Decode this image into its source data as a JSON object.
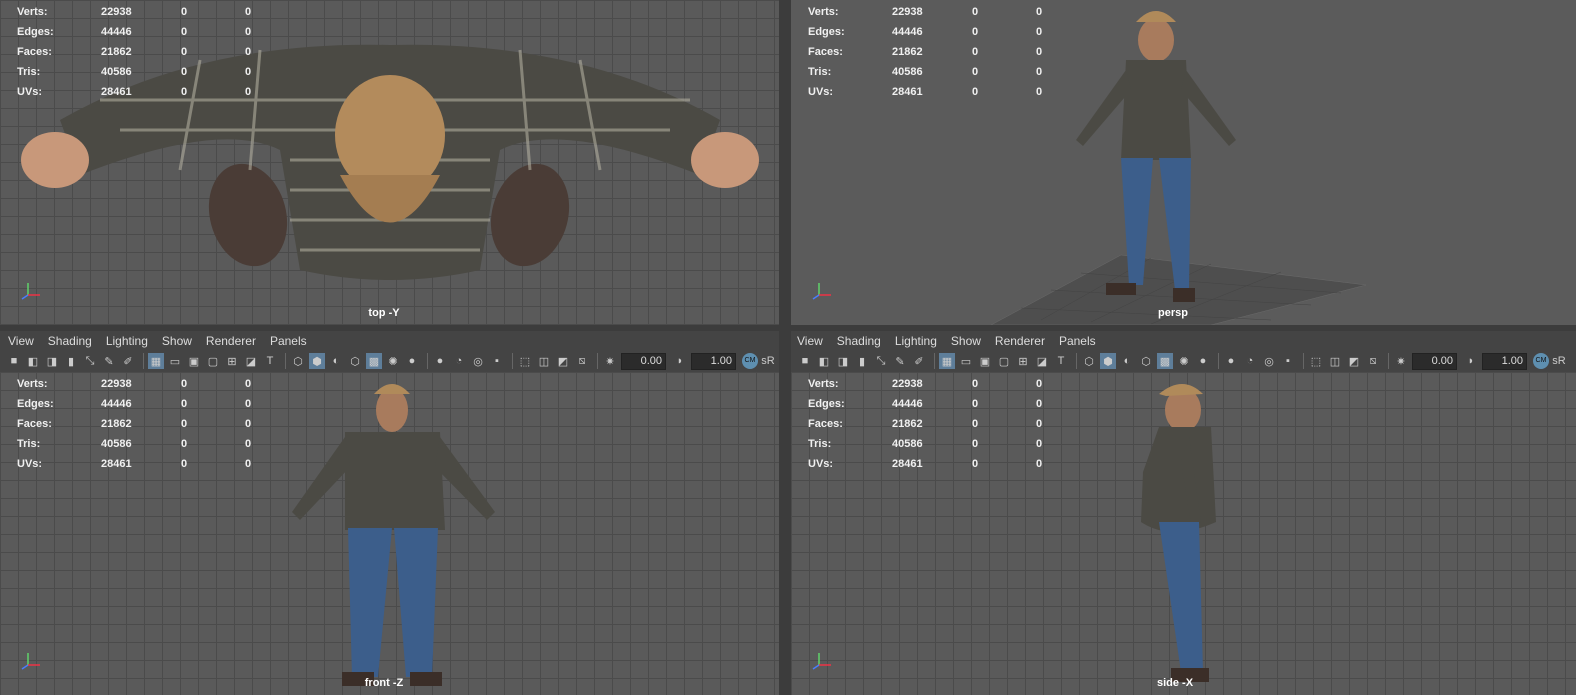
{
  "hud": {
    "labels": [
      "Verts:",
      "Edges:",
      "Faces:",
      "Tris:",
      "UVs:"
    ],
    "values": [
      [
        "22938",
        "0",
        "0"
      ],
      [
        "44446",
        "0",
        "0"
      ],
      [
        "21862",
        "0",
        "0"
      ],
      [
        "40586",
        "0",
        "0"
      ],
      [
        "28461",
        "0",
        "0"
      ]
    ]
  },
  "viewports": {
    "top": "top -Y",
    "persp": "persp",
    "front": "front -Z",
    "side": "side -X"
  },
  "menu": [
    "View",
    "Shading",
    "Lighting",
    "Show",
    "Renderer",
    "Panels"
  ],
  "toolbar": {
    "near_value": "0.00",
    "far_value": "1.00",
    "srgb_label": "sR",
    "srgb_badge": "CM"
  },
  "colors": {
    "viewport_bg": "#5a5a5a",
    "grid": "#4b4b4b",
    "active_tool": "#5e7e9a"
  }
}
